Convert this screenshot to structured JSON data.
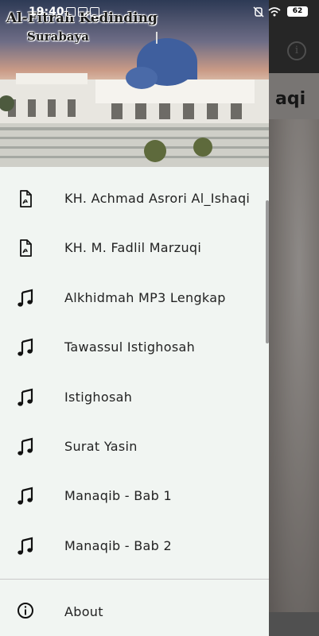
{
  "status_bar": {
    "time": "19:40",
    "battery": "62"
  },
  "background": {
    "partial_title": "aqi",
    "info_icon": "info-icon"
  },
  "drawer": {
    "header": {
      "title": "Al-Fitrah Kedinding",
      "subtitle": "Surabaya"
    },
    "items": [
      {
        "label": "KH. Achmad Asrori Al_Ishaqi",
        "icon": "pdf-file-icon"
      },
      {
        "label": "KH. M. Fadlil Marzuqi",
        "icon": "pdf-file-icon"
      },
      {
        "label": "Alkhidmah MP3 Lengkap",
        "icon": "music-note-icon"
      },
      {
        "label": "Tawassul Istighosah",
        "icon": "music-note-icon"
      },
      {
        "label": "Istighosah",
        "icon": "music-note-icon"
      },
      {
        "label": "Surat Yasin",
        "icon": "music-note-icon"
      },
      {
        "label": "Manaqib - Bab 1",
        "icon": "music-note-icon"
      },
      {
        "label": "Manaqib - Bab 2",
        "icon": "music-note-icon"
      }
    ],
    "about": {
      "label": "About",
      "icon": "info-icon"
    }
  }
}
